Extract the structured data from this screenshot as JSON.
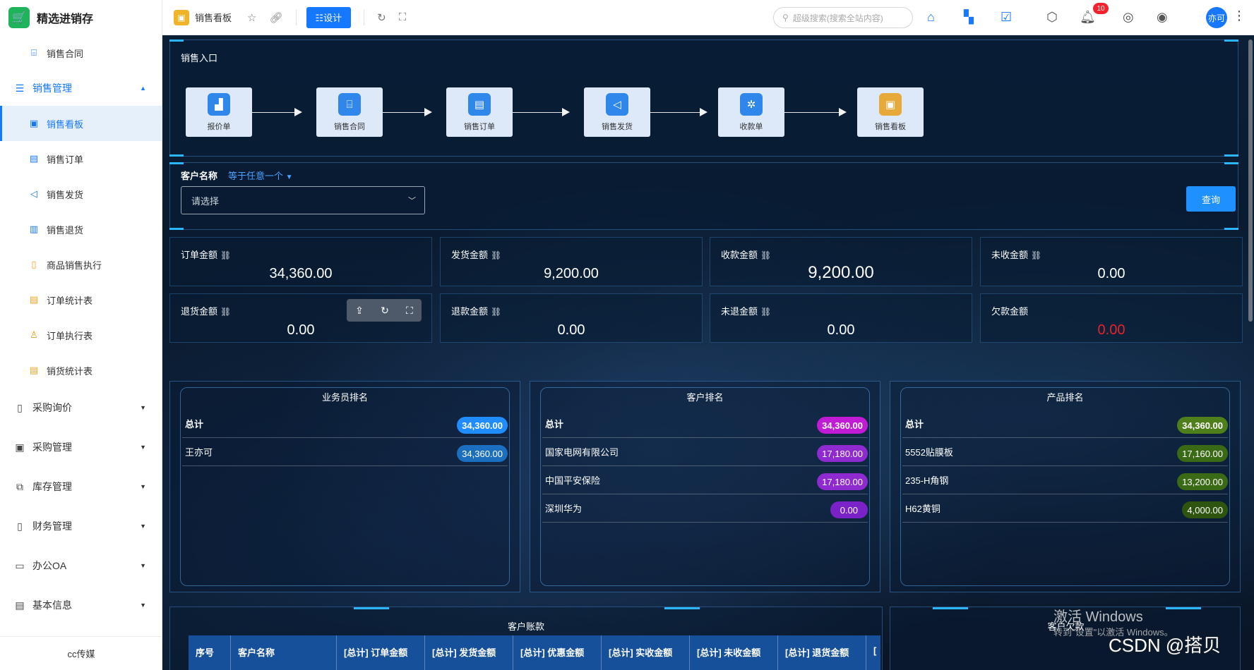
{
  "app": {
    "title": "精选进销存",
    "logo_glyph": "🛒"
  },
  "sidebar": {
    "top_items": [
      {
        "label": "销售合同",
        "icon": "briefcase-icon"
      }
    ],
    "group_sales": {
      "label": "销售管理",
      "open": true
    },
    "sales_items": [
      {
        "label": "销售看板",
        "active": true
      },
      {
        "label": "销售订单"
      },
      {
        "label": "销售发货"
      },
      {
        "label": "销售退货"
      },
      {
        "label": "商品销售执行"
      },
      {
        "label": "订单统计表"
      },
      {
        "label": "订单执行表"
      },
      {
        "label": "销货统计表"
      }
    ],
    "groups": [
      {
        "label": "采购询价"
      },
      {
        "label": "采购管理"
      },
      {
        "label": "库存管理"
      },
      {
        "label": "财务管理"
      },
      {
        "label": "办公OA"
      },
      {
        "label": "基本信息"
      }
    ],
    "footer": "cc传媒"
  },
  "topbar": {
    "page_title": "销售看板",
    "design_label": "☷设计",
    "search_placeholder": "超级搜索(搜索全站内容)",
    "notification_count": "10",
    "avatar_text": "亦可"
  },
  "flow": {
    "title": "销售入口",
    "nodes": [
      {
        "label": "报价单",
        "icon": "chart-icon"
      },
      {
        "label": "销售合同",
        "icon": "briefcase-icon"
      },
      {
        "label": "销售订单",
        "icon": "document-icon"
      },
      {
        "label": "销售发货",
        "icon": "megaphone-icon"
      },
      {
        "label": "收款单",
        "icon": "puzzle-icon"
      },
      {
        "label": "销售看板",
        "icon": "board-icon"
      }
    ]
  },
  "filter": {
    "label": "客户名称",
    "mode": "等于任意一个",
    "select_placeholder": "请选择",
    "query_label": "查询"
  },
  "stats": [
    {
      "label": "订单金额",
      "value": "34,360.00"
    },
    {
      "label": "发货金额",
      "value": "9,200.00"
    },
    {
      "label": "收款金额",
      "value": "9,200.00"
    },
    {
      "label": "未收金额",
      "value": "0.00"
    },
    {
      "label": "退货金额",
      "value": "0.00"
    },
    {
      "label": "退款金额",
      "value": "0.00"
    },
    {
      "label": "未退金额",
      "value": "0.00"
    },
    {
      "label": "欠款金额",
      "value": "0.00"
    }
  ],
  "rankings": [
    {
      "title": "业务员排名",
      "rows": [
        {
          "name": "总计",
          "value": "34,360.00"
        },
        {
          "name": "王亦可",
          "value": "34,360.00"
        }
      ]
    },
    {
      "title": "客户排名",
      "rows": [
        {
          "name": "总计",
          "value": "34,360.00"
        },
        {
          "name": "国家电网有限公司",
          "value": "17,180.00"
        },
        {
          "name": "中国平安保险",
          "value": "17,180.00"
        },
        {
          "name": "深圳华为",
          "value": "0.00"
        }
      ]
    },
    {
      "title": "产品排名",
      "rows": [
        {
          "name": "总计",
          "value": "34,360.00"
        },
        {
          "name": "5552贴膜板",
          "value": "17,160.00"
        },
        {
          "name": "235-H角钢",
          "value": "13,200.00"
        },
        {
          "name": "H62黄铜",
          "value": "4,000.00"
        }
      ]
    }
  ],
  "bottom": {
    "left_title": "客户账款",
    "right_title": "客户欠款",
    "columns": [
      "序号",
      "客户名称",
      "[总计] 订单金额",
      "[总计] 发货金额",
      "[总计] 优惠金额",
      "[总计] 实收金额",
      "[总计] 未收金额",
      "[总计] 退货金额",
      "["
    ]
  },
  "overlay": {
    "win_activate": "激活 Windows",
    "win_activate_sub": "转到\"设置\"以激活 Windows。",
    "csdn": "CSDN @搭贝"
  }
}
